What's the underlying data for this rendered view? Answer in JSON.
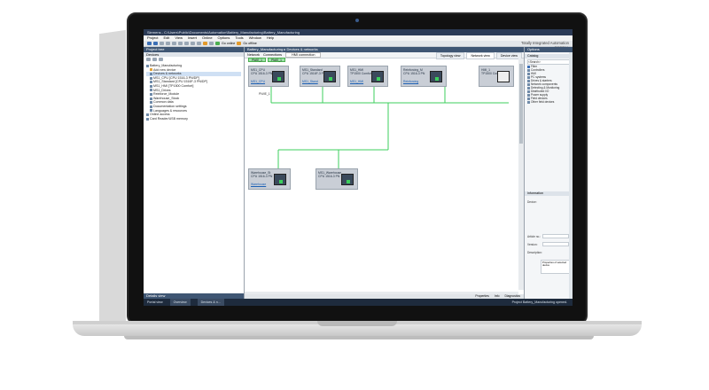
{
  "app": {
    "title": "Siemens - C:\\Users\\Public\\Documents\\Automation\\Battery_Manufacturing\\Battery_Manufacturing",
    "brand_line1": "Totally Integrated Automation",
    "brand_line2": "PORTAL",
    "menu": [
      "Project",
      "Edit",
      "View",
      "Insert",
      "Online",
      "Options",
      "Tools",
      "Window",
      "Help"
    ],
    "toolbar_online": "Go online",
    "toolbar_offline": "Go offline"
  },
  "project_tree": {
    "header": "Project tree",
    "sub": "Devices",
    "items": [
      {
        "label": "Battery_Manufacturing",
        "selected": false
      },
      {
        "label": "Add new device",
        "selected": false
      },
      {
        "label": "Devices & networks",
        "selected": true
      },
      {
        "label": "MS1_CPU [CPU 1516-3 PN/DP]",
        "selected": false
      },
      {
        "label": "MS1_Standard [CPU 1516F-3 PN/DP]",
        "selected": false
      },
      {
        "label": "MS1_HMI [TP1500 Comfort]",
        "selected": false
      },
      {
        "label": "MS1_Drives",
        "selected": false
      },
      {
        "label": "Reinforce_Module",
        "selected": false
      },
      {
        "label": "Warehouse_Stock",
        "selected": false
      },
      {
        "label": "Common data",
        "selected": false
      },
      {
        "label": "Documentation settings",
        "selected": false
      },
      {
        "label": "Languages & resources",
        "selected": false
      },
      {
        "label": "Online access",
        "selected": false
      },
      {
        "label": "Card Reader/USB memory",
        "selected": false
      }
    ],
    "details_view": "Details view"
  },
  "editor": {
    "breadcrumb": "Battery_Manufacturing ▸ Devices & networks",
    "tools": [
      "Network",
      "Connections",
      "HMI connection"
    ],
    "views": [
      "Topology view",
      "Network view",
      "Device view"
    ],
    "subnet_label": "PN/IE_1",
    "net_pills": [
      "PN/IE_1",
      "PN/IE_1"
    ],
    "devices": [
      {
        "name": "MS1_CPU",
        "type": "CPU 1516-3 PN/DP",
        "link": "MS1_CPU"
      },
      {
        "name": "MS1_Standard",
        "type": "CPU 1516F-3 PN",
        "link": "MS1_Stand"
      },
      {
        "name": "MS1_HMI",
        "type": "TP1500 Comfort",
        "link": "MS1_HMI"
      },
      {
        "name": "Reinforcing_M",
        "type": "CPU 1516-3 PN",
        "link": "Reinforcing"
      },
      {
        "name": "HMI_1",
        "type": "TP1500 Comfort",
        "link": ""
      },
      {
        "name": "Warehouse_St",
        "type": "CPU 1516-3 PN",
        "link": "Warehouse"
      },
      {
        "name": "MS1_Warehouse",
        "type": "CPU 1516-3 PN",
        "link": ""
      }
    ],
    "footer_tabs": [
      "Properties",
      "Info",
      "Diagnostics"
    ]
  },
  "tasks": {
    "options": "Options",
    "catalog": "Catalog",
    "catalog_search": "<Search>",
    "filter": "Filter",
    "catalog_items": [
      "Controllers",
      "HMI",
      "PC systems",
      "Drives & starters",
      "Network components",
      "Detecting & Monitoring",
      "Distributed I/O",
      "Power supply",
      "Field devices",
      "Other field devices"
    ],
    "information": "Information",
    "info_fields": [
      "Device:",
      "Article no.:",
      "Version:",
      "Description:"
    ],
    "info_note": "Properties of selected device"
  },
  "statusbar": {
    "portal_view": "Portal view",
    "overview": "Overview",
    "devices_tab": "Devices & n...",
    "message": "Project Battery_Manufacturing opened."
  }
}
